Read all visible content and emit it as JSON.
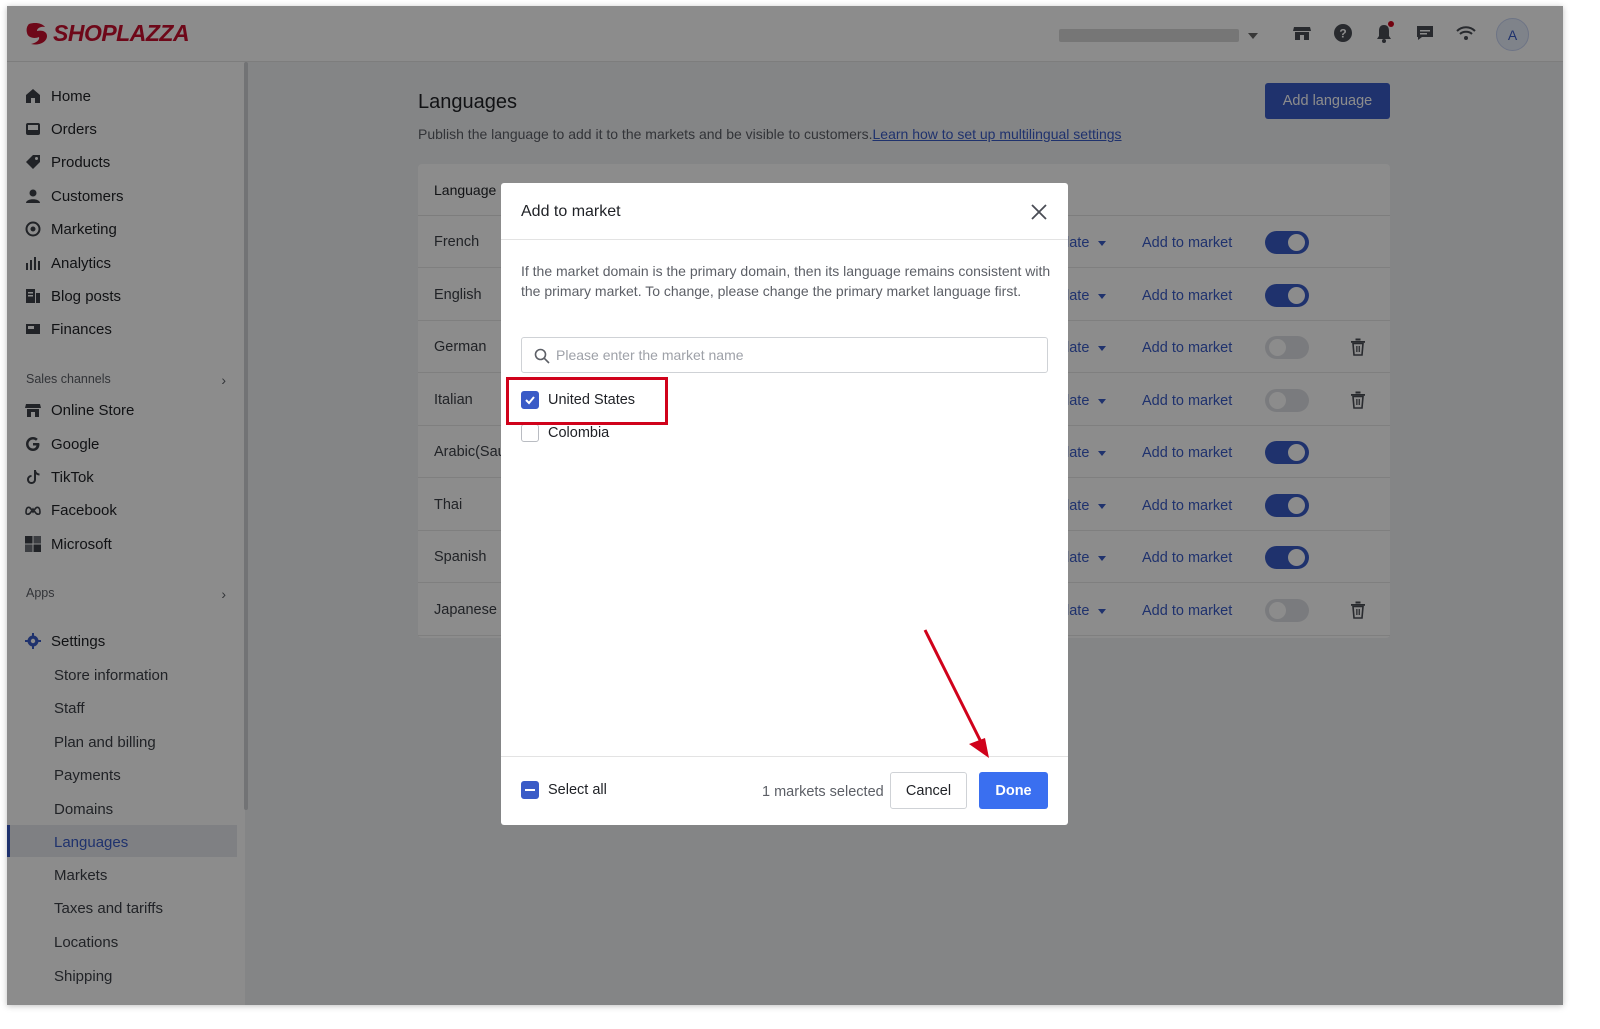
{
  "header": {
    "brand": "SHOPLAZZA",
    "avatar_initial": "A"
  },
  "sidebar": {
    "items": [
      {
        "label": "Home",
        "icon": "home-icon"
      },
      {
        "label": "Orders",
        "icon": "orders-icon"
      },
      {
        "label": "Products",
        "icon": "tag-icon"
      },
      {
        "label": "Customers",
        "icon": "person-icon"
      },
      {
        "label": "Marketing",
        "icon": "marketing-icon"
      },
      {
        "label": "Analytics",
        "icon": "bar-chart-icon"
      },
      {
        "label": "Blog posts",
        "icon": "blog-icon"
      },
      {
        "label": "Finances",
        "icon": "finances-icon"
      }
    ],
    "sales_channels_label": "Sales channels",
    "channels": [
      {
        "label": "Online Store",
        "icon": "store-icon"
      },
      {
        "label": "Google",
        "icon": "google-icon"
      },
      {
        "label": "TikTok",
        "icon": "tiktok-icon"
      },
      {
        "label": "Facebook",
        "icon": "meta-icon"
      },
      {
        "label": "Microsoft",
        "icon": "microsoft-icon"
      }
    ],
    "apps_label": "Apps",
    "settings_label": "Settings",
    "settings_items": [
      "Store information",
      "Staff",
      "Plan and billing",
      "Payments",
      "Domains",
      "Languages",
      "Markets",
      "Taxes and tariffs",
      "Locations",
      "Shipping"
    ],
    "active_item": "Languages"
  },
  "main": {
    "title": "Languages",
    "subtitle": "Publish the language to add it to the markets and be visible to customers.",
    "learn_link": "Learn how to set up multilingual settings",
    "add_button": "Add language",
    "table": {
      "header_language": "Language",
      "rows": [
        {
          "name": "French",
          "translate": "late",
          "market": "Add to market",
          "published": true,
          "deletable": false
        },
        {
          "name": "English",
          "translate": "late",
          "market": "Add to market",
          "published": true,
          "deletable": false
        },
        {
          "name": "German",
          "translate": "late",
          "market": "Add to market",
          "published": false,
          "deletable": true
        },
        {
          "name": "Italian",
          "translate": "late",
          "market": "Add to market",
          "published": false,
          "deletable": true
        },
        {
          "name": "Arabic(Sau",
          "translate": "late",
          "market": "Add to market",
          "published": true,
          "deletable": false
        },
        {
          "name": "Thai",
          "translate": "late",
          "market": "Add to market",
          "published": true,
          "deletable": false
        },
        {
          "name": "Spanish",
          "translate": "late",
          "market": "Add to market",
          "published": true,
          "deletable": false
        },
        {
          "name": "Japanese",
          "translate": "late",
          "market": "Add to market",
          "published": false,
          "deletable": true
        }
      ]
    }
  },
  "modal": {
    "title": "Add to market",
    "description": "If the market domain is the primary domain, then its language remains consistent with the primary market. To change, please change the primary market language first.",
    "search_placeholder": "Please enter the market name",
    "search_value": "",
    "markets": [
      {
        "name": "United States",
        "checked": true
      },
      {
        "name": "Colombia",
        "checked": false
      }
    ],
    "select_all_label": "Select all",
    "selected_count": "1 markets selected",
    "cancel_label": "Cancel",
    "done_label": "Done"
  },
  "colors": {
    "accent": "#3a5bc7",
    "done_button": "#3a6ff0",
    "annotation_red": "#d0021b",
    "brand_red": "#c8102e"
  }
}
